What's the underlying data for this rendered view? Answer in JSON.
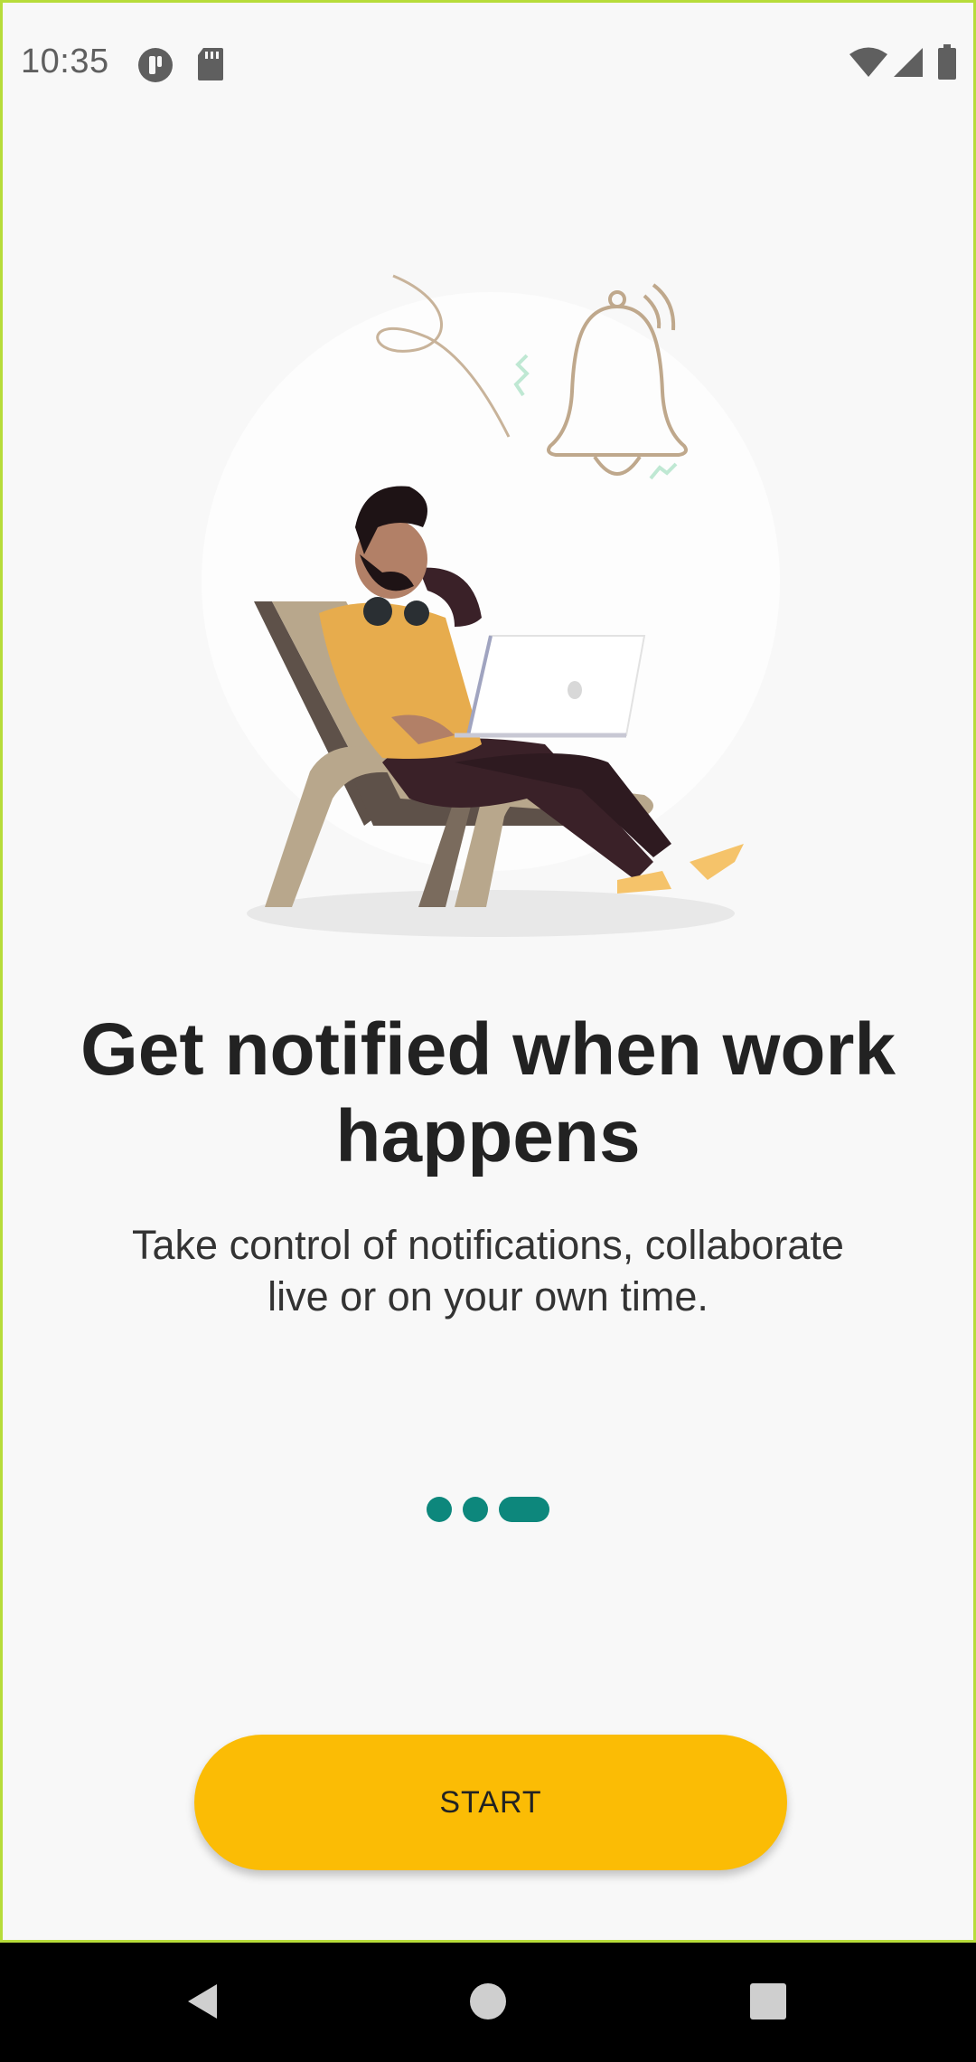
{
  "status_bar": {
    "time": "10:35",
    "left_icons": [
      "alert-circle-icon",
      "sd-card-icon"
    ],
    "right_icons": [
      "wifi-icon",
      "cellular-signal-icon",
      "battery-icon"
    ]
  },
  "onboarding": {
    "title": "Get notified when work happens",
    "subtitle": "Take control of notifications, collaborate live or on your own time.",
    "pager": {
      "total_pages": 3,
      "current_page": 3
    },
    "start_button_label": "START",
    "illustration_icon": "person-in-lounge-chair-with-laptop-and-bell-illustration"
  },
  "navigation_bar": {
    "icons": [
      "back-icon",
      "home-icon",
      "recents-icon"
    ]
  },
  "colors": {
    "accent": "#fbbc05",
    "pager_dot": "#0d877c",
    "title_text": "#222222",
    "background": "#f8f8f8",
    "frame_border": "#b7dc3a"
  }
}
